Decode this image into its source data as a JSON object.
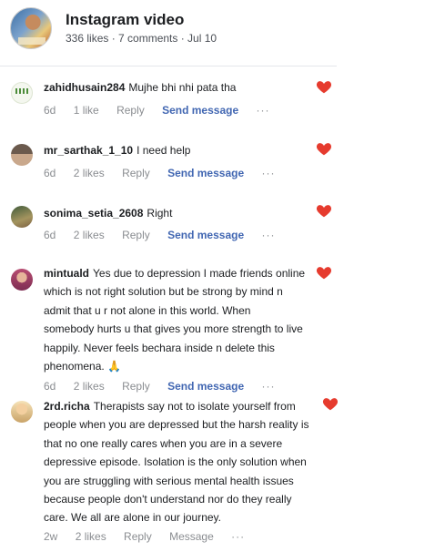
{
  "post": {
    "title": "Instagram video",
    "meta": "336 likes · 7 comments · Jul 10"
  },
  "colors": {
    "heart": "#e63b2e",
    "link": "#4267b2",
    "muted": "#8a8d91"
  },
  "comments": [
    {
      "username": "zahidhusain284",
      "lines": [
        "Mujhe bhi nhi pata tha"
      ],
      "time": "6d",
      "likes": "1 like",
      "reply": "Reply",
      "send": "Send message",
      "more": "···"
    },
    {
      "username": "mr_sarthak_1_10",
      "lines": [
        "I need help"
      ],
      "time": "6d",
      "likes": "2 likes",
      "reply": "Reply",
      "send": "Send message",
      "more": "···"
    },
    {
      "username": "sonima_setia_2608",
      "lines": [
        "Right"
      ],
      "time": "6d",
      "likes": "2 likes",
      "reply": "Reply",
      "send": "Send message",
      "more": "···"
    },
    {
      "username": "mintuald",
      "lines": [
        "Yes due to depression I made friends online",
        "which is not right solution but be strong by mind n",
        "admit that u r not alone in this world. When",
        "somebody hurts u that gives you more strength to live",
        "happily. Never feels bechara inside n delete this",
        "phenomena. 🙏"
      ],
      "time": "6d",
      "likes": "2 likes",
      "reply": "Reply",
      "send": "Send message",
      "more": "···"
    },
    {
      "username": "2rd.richa",
      "lines": [
        "Therapists say not to isolate yourself from",
        "people when you are depressed but the harsh reality is",
        "that no one really cares when you are in a severe",
        "depressive episode. Isolation is the only solution when",
        "you are struggling with serious mental health issues",
        "because people don't understand nor do they really",
        "care. We all are alone in our journey."
      ],
      "time": "2w",
      "likes": "2 likes",
      "reply": "Reply",
      "send": "Message",
      "more": "···"
    }
  ]
}
